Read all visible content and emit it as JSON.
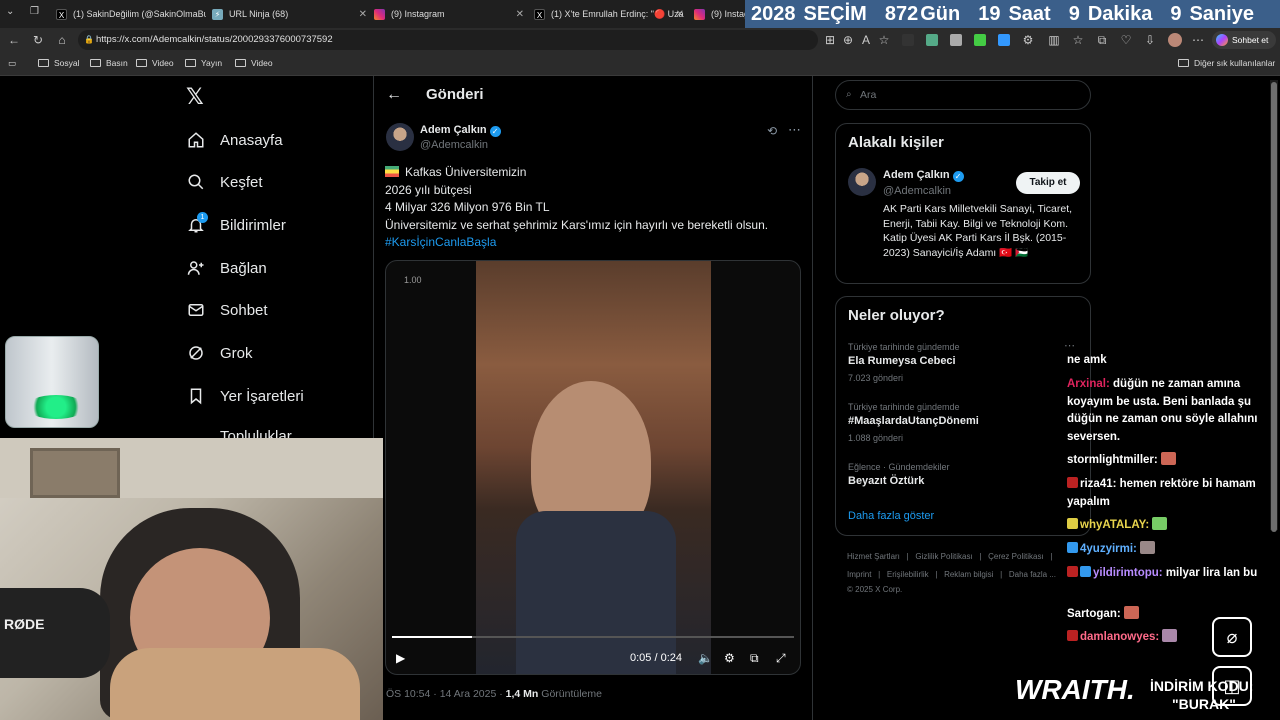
{
  "browser": {
    "tabs": [
      {
        "label": "(1) SakinDeğilim (@SakinOlmaBur...",
        "icon": "x-logo-icon"
      },
      {
        "label": "URL Ninja (68)",
        "icon": "url-ninja-icon"
      },
      {
        "label": "(9) Instagram",
        "icon": "instagram-icon"
      },
      {
        "label": "(1) X'te Emrullah Erdinç: \"🔴 Uzakl...",
        "icon": "x-logo-icon"
      },
      {
        "label": "(9) Instag",
        "icon": "instagram-icon"
      }
    ],
    "url": "https://x.com/Ademcalkin/status/2000293376000737592",
    "sohbet_label": "Sohbet et",
    "bookmarks": [
      "Sosyal",
      "Basın",
      "Video",
      "Yayın",
      "Video"
    ],
    "other_bookmarks": "Diğer sık kullanılanlar"
  },
  "countdown": {
    "year": "2028",
    "title": "SEÇİM",
    "days": "872",
    "days_unit": "Gün",
    "hours": "19",
    "hours_unit": "Saat",
    "minutes": "9",
    "minutes_unit": "Dakika",
    "seconds": "9",
    "seconds_unit": "Saniye"
  },
  "nav": {
    "items": [
      {
        "label": "Anasayfa",
        "icon": "home-icon"
      },
      {
        "label": "Keşfet",
        "icon": "search-icon"
      },
      {
        "label": "Bildirimler",
        "icon": "bell-icon",
        "badge": "1"
      },
      {
        "label": "Bağlan",
        "icon": "add-person-icon"
      },
      {
        "label": "Sohbet",
        "icon": "mail-icon"
      },
      {
        "label": "Grok",
        "icon": "grok-icon"
      },
      {
        "label": "Yer İşaretleri",
        "icon": "bookmark-icon"
      },
      {
        "label": "Topluluklar",
        "icon": "communities-icon"
      }
    ]
  },
  "post": {
    "header": "Gönderi",
    "author_name": "Adem Çalkın",
    "author_handle": "@Ademcalkin",
    "lines": [
      "Kafkas Üniversitemizin",
      "2026 yılı bütçesi",
      "4 Milyar 326 Milyon 976 Bin TL",
      "Üniversitemiz ve serhat şehrimiz Kars'ımız için hayırlı ve bereketli olsun."
    ],
    "hashtag": "#KarsİçinCanlaBaşla",
    "video": {
      "speed": "1.00",
      "time": "0:05 / 0:24",
      "progress_fraction": 0.2
    },
    "timestamp": "ÖS 10:54 · 14 Ara 2025 · ",
    "views": "1,4 Mn",
    "views_label": " Görüntüleme"
  },
  "sidebar": {
    "search_placeholder": "Ara",
    "relevant_title": "Alakalı kişiler",
    "person": {
      "name": "Adem Çalkın",
      "handle": "@Ademcalkin",
      "follow_label": "Takip et",
      "bio": "AK Parti Kars Milletvekili Sanayi, Ticaret, Enerji, Tabii Kay. Bilgi ve Teknoloji Kom. Katip Üyesi AK Parti Kars İl Bşk. (2015-2023) Sanayici/İş Adamı 🇹🇷 🇵🇸"
    },
    "trends_title": "Neler oluyor?",
    "trends": [
      {
        "context": "Türkiye tarihinde gündemde",
        "name": "Ela Rumeysa Cebeci",
        "count": "7.023 gönderi"
      },
      {
        "context": "Türkiye tarihinde gündemde",
        "name": "#MaaşlardaUtançDönemi",
        "count": "1.088 gönderi"
      },
      {
        "context": "Eğlence · Gündemdekiler",
        "name": "Beyazıt Öztürk",
        "count": ""
      }
    ],
    "show_more": "Daha fazla göster",
    "footer_row1": [
      "Hizmet Şartları",
      "|",
      "Gizlilik Politikası",
      "|",
      "Çerez Politikası",
      "|"
    ],
    "footer_row2": [
      "Imprint",
      "|",
      "Erişilebilirlik",
      "|",
      "Reklam bilgisi",
      "|",
      "Daha fazla ..."
    ],
    "copyright": "© 2025 X Corp."
  },
  "chat": {
    "lines": [
      {
        "user": "",
        "text": "ne amk",
        "color": "#ffffff"
      },
      {
        "user": "Arxinal:",
        "text": " düğün ne zaman amına koyayım be usta. Beni banlada şu düğün ne zaman onu söyle allahını seversen.",
        "color": "#e0245e"
      },
      {
        "user": "stormlightmiller:",
        "text": "",
        "color": "#ffffff"
      },
      {
        "user": "riza41:",
        "text": " hemen rektöre bi hamam yapalım",
        "color": "#ffffff"
      },
      {
        "user": "whyATALAY:",
        "text": "",
        "color": "#e8d44d"
      },
      {
        "user": "4yuzyirmi:",
        "text": "",
        "color": "#5fb0ff"
      },
      {
        "user": "yildirimtopu:",
        "text": " milyar lira lan bu",
        "color": "#b88cff"
      },
      {
        "user": "Sartogan:",
        "text": "",
        "color": "#ffffff"
      },
      {
        "user": "damlanowyes:",
        "text": "",
        "color": "#ff6b8a"
      }
    ]
  },
  "overlay": {
    "brand": "WRAITH.",
    "promo": "İNDİRİM KODU:",
    "code": "\"BURAK\"",
    "mic_brand": "RØDE"
  }
}
